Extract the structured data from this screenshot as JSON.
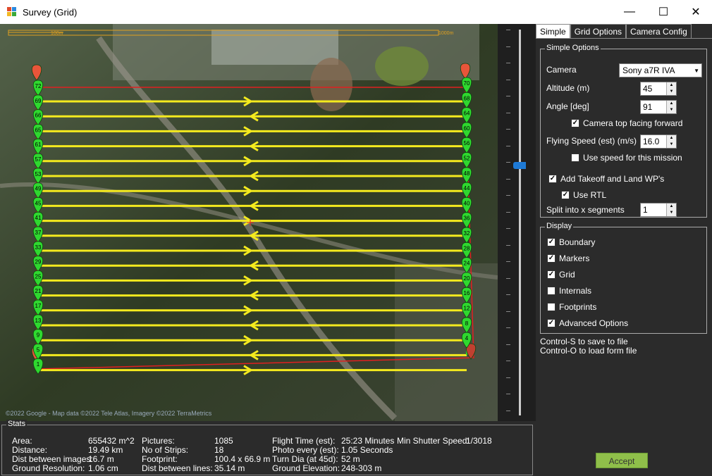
{
  "window": {
    "title": "Survey (Grid)"
  },
  "map": {
    "scale_small": "100m",
    "scale_large": "1000m",
    "attribution": "©2022 Google - Map data ©2022 Tele Atlas, Imagery ©2022 TerraMetrics",
    "left_markers": [
      "72",
      "69",
      "66",
      "65",
      "61",
      "57",
      "53",
      "49",
      "45",
      "41",
      "37",
      "33",
      "29",
      "25",
      "21",
      "17",
      "13",
      "9",
      "5",
      "1"
    ],
    "right_markers": [
      "70",
      "68",
      "64",
      "60",
      "56",
      "52",
      "48",
      "44",
      "40",
      "36",
      "32",
      "28",
      "24",
      "20",
      "16",
      "12",
      "8",
      "4"
    ]
  },
  "tabs": [
    "Simple",
    "Grid Options",
    "Camera Config"
  ],
  "simple_options": {
    "legend": "Simple Options",
    "camera_label": "Camera",
    "camera_value": "Sony a7R IVA",
    "altitude_label": "Altitude (m)",
    "altitude_value": "45",
    "angle_label": "Angle [deg]",
    "angle_value": "91",
    "camera_top_label": "Camera top facing forward",
    "flying_speed_label": "Flying Speed (est) (m/s)",
    "flying_speed_value": "16.0",
    "use_speed_label": "Use speed for this mission",
    "takeoff_land_label": "Add Takeoff and Land WP's",
    "use_rtl_label": "Use RTL",
    "split_label": "Split into x segments",
    "split_value": "1"
  },
  "display": {
    "legend": "Display",
    "boundary": "Boundary",
    "markers": "Markers",
    "grid": "Grid",
    "internals": "Internals",
    "footprints": "Footprints",
    "advanced": "Advanced Options"
  },
  "hints": {
    "save": "Control-S to save to file",
    "load": "Control-O to load form file"
  },
  "accept_label": "Accept",
  "stats": {
    "legend": "Stats",
    "area_label": "Area:",
    "area": "655432 m^2",
    "distance_label": "Distance:",
    "distance": "19.49 km",
    "dist_images_label": "Dist between images:",
    "dist_images": "16.7 m",
    "ground_res_label": "Ground Resolution:",
    "ground_res": "1.06 cm",
    "pictures_label": "Pictures:",
    "pictures": "1085",
    "strips_label": "No of Strips:",
    "strips": "18",
    "footprint_label": "Footprint:",
    "footprint": "100.4 x 66.9 m",
    "dist_lines_label": "Dist between lines:",
    "dist_lines": "35.14 m",
    "flight_time_label": "Flight Time (est):",
    "flight_time": "25:23 Minutes",
    "photo_every_label": "Photo every (est):",
    "photo_every": "1.05 Seconds",
    "turn_dia_label": "Turn Dia (at 45d):",
    "turn_dia": "52 m",
    "ground_elev_label": "Ground Elevation:",
    "ground_elev": "248-303 m",
    "shutter_label": "Min Shutter Speed:",
    "shutter": "1/3018"
  }
}
